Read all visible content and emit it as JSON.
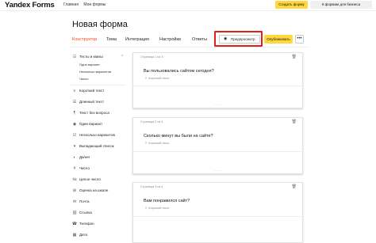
{
  "app": {
    "logo": "Yandex Forms",
    "nav": [
      "Главная",
      "Мои формы"
    ],
    "create_button": "Создать форму",
    "business_button": "К формам для бизнеса"
  },
  "form": {
    "title": "Новая форма",
    "tabs": [
      "Конструктор",
      "Тема",
      "Интеграция",
      "Настройки",
      "Ответы"
    ],
    "active_tab": "Конструктор",
    "preview_button": "Предпросмотр",
    "publish_button": "Опубликовать",
    "more_button": "•••"
  },
  "sidebar": {
    "group": {
      "label": "Тесты и квизы",
      "items": [
        "Один вариант",
        "Несколько вариантов",
        "Число"
      ]
    },
    "items": [
      {
        "label": "Короткий текст",
        "icon": "short-text-icon",
        "glyph": "≡"
      },
      {
        "label": "Длинный текст",
        "icon": "long-text-icon",
        "glyph": "☰"
      },
      {
        "label": "Текст без вопроса",
        "icon": "text-icon",
        "glyph": "¶"
      },
      {
        "label": "Один вариант",
        "icon": "radio-icon",
        "glyph": "◉"
      },
      {
        "label": "Несколько вариантов",
        "icon": "checkbox-icon",
        "glyph": "☑"
      },
      {
        "label": "Выпадающий список",
        "icon": "dropdown-icon",
        "glyph": "▾"
      },
      {
        "label": "Да/нет",
        "icon": "toggle-icon",
        "glyph": "◐"
      },
      {
        "label": "Число",
        "icon": "number-icon",
        "glyph": "#"
      },
      {
        "label": "Целое число",
        "icon": "integer-icon",
        "glyph": "№"
      },
      {
        "label": "Оценка на шкале",
        "icon": "scale-icon",
        "glyph": "⊞"
      },
      {
        "label": "Почта",
        "icon": "mail-icon",
        "glyph": "✉"
      },
      {
        "label": "Ссылка",
        "icon": "link-icon",
        "glyph": "⛓"
      },
      {
        "label": "Телефон",
        "icon": "phone-icon",
        "glyph": "☎"
      },
      {
        "label": "Дата",
        "icon": "calendar-icon",
        "glyph": "▦"
      }
    ]
  },
  "questions": [
    {
      "page": "Страница 1 из 4",
      "text": "Вы пользовались сайтом сегодня?",
      "type": "Короткий текст"
    },
    {
      "page": "Страница 2 из 4",
      "text": "Сколько минут вы были на сайте?",
      "type": "Короткий текст"
    },
    {
      "page": "Страница 3 из 4",
      "text": "Вам понравился сайт?",
      "type": "Короткий текст"
    }
  ],
  "colors": {
    "accent": "#ffd83d",
    "active_tab": "#fc3f1d",
    "highlight": "#e0201b"
  }
}
